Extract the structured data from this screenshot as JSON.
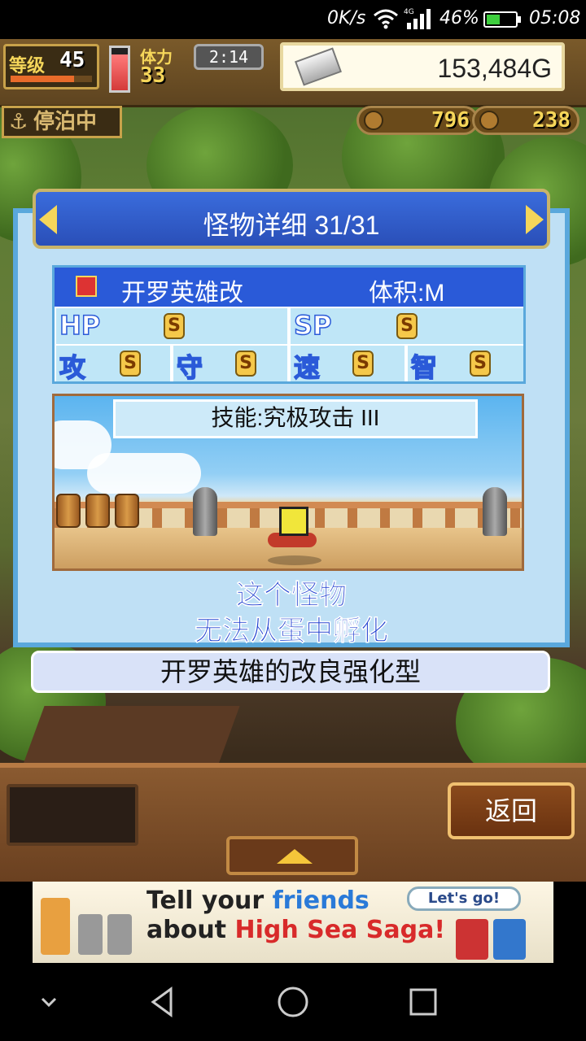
{
  "status_bar": {
    "net_speed": "0K/s",
    "network_type": "4G",
    "battery_percent": "46%",
    "battery_level": 0.46,
    "time": "05:08"
  },
  "hud": {
    "level_label": "等级",
    "level_value": "45",
    "stamina_label": "体力",
    "stamina_value": "33",
    "timer": "2:14",
    "gold_value": "153,484G",
    "docked_label": "停泊中",
    "resource_1": "796",
    "resource_2": "238"
  },
  "panel": {
    "title": "怪物详细 31/31",
    "monster_name": "开罗英雄改",
    "size": "体积:M",
    "stats": [
      {
        "label": "HP",
        "grade": "S"
      },
      {
        "label": "SP",
        "grade": "S"
      },
      {
        "label": "攻",
        "grade": "S"
      },
      {
        "label": "守",
        "grade": "S"
      },
      {
        "label": "速",
        "grade": "S"
      },
      {
        "label": "智",
        "grade": "S"
      }
    ],
    "skill": "技能:究极攻击 III",
    "notice_line1": "这个怪物",
    "notice_line2": "无法从蛋中孵化",
    "description": "开罗英雄的改良强化型"
  },
  "bottom": {
    "back_label": "返回"
  },
  "ad": {
    "line1_a": "Tell your ",
    "line1_b": "friends",
    "line2_a": "about ",
    "line2_b": "High Sea Saga!",
    "cta": "Let's go!"
  },
  "colors": {
    "panel_blue": "#2a5ad8",
    "panel_bg": "#bfe0f5",
    "notice_text": "#1e3fd0",
    "gold_accent": "#f5d65a"
  }
}
